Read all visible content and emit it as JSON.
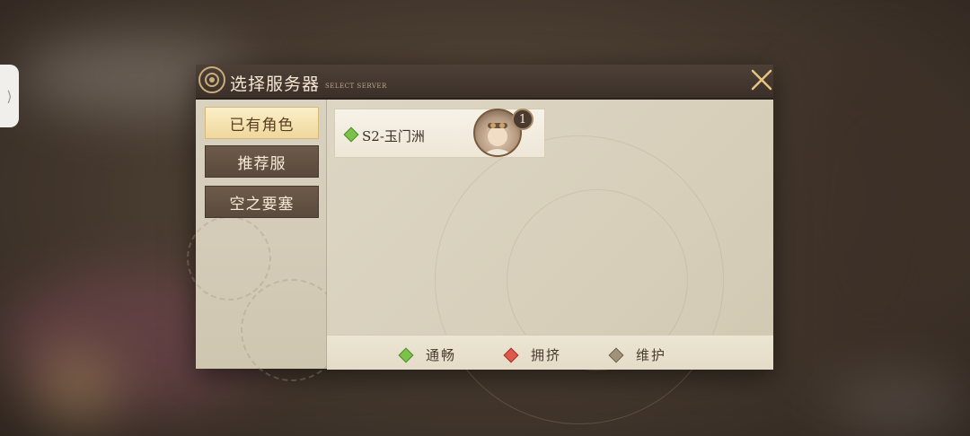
{
  "side_tab": {
    "icon": "chevron-right-icon",
    "glyph": "⟩"
  },
  "dialog": {
    "title": "选择服务器",
    "subtitle": "SELECT SERVER",
    "emblem_icon": "gear-emblem-icon",
    "close_icon": "close-icon"
  },
  "tabs": [
    {
      "label": "已有角色",
      "active": true
    },
    {
      "label": "推荐服",
      "active": false
    },
    {
      "label": "空之要塞",
      "active": false
    }
  ],
  "servers": [
    {
      "name": "S2-玉门洲",
      "status": "smooth",
      "character_count": "1",
      "avatar_icon": "character-avatar"
    }
  ],
  "legend": [
    {
      "label": "通畅",
      "status": "smooth",
      "color": "#7cc24a"
    },
    {
      "label": "拥挤",
      "status": "crowded",
      "color": "#e0584a"
    },
    {
      "label": "维护",
      "status": "maintenance",
      "color": "#a2927a"
    }
  ]
}
